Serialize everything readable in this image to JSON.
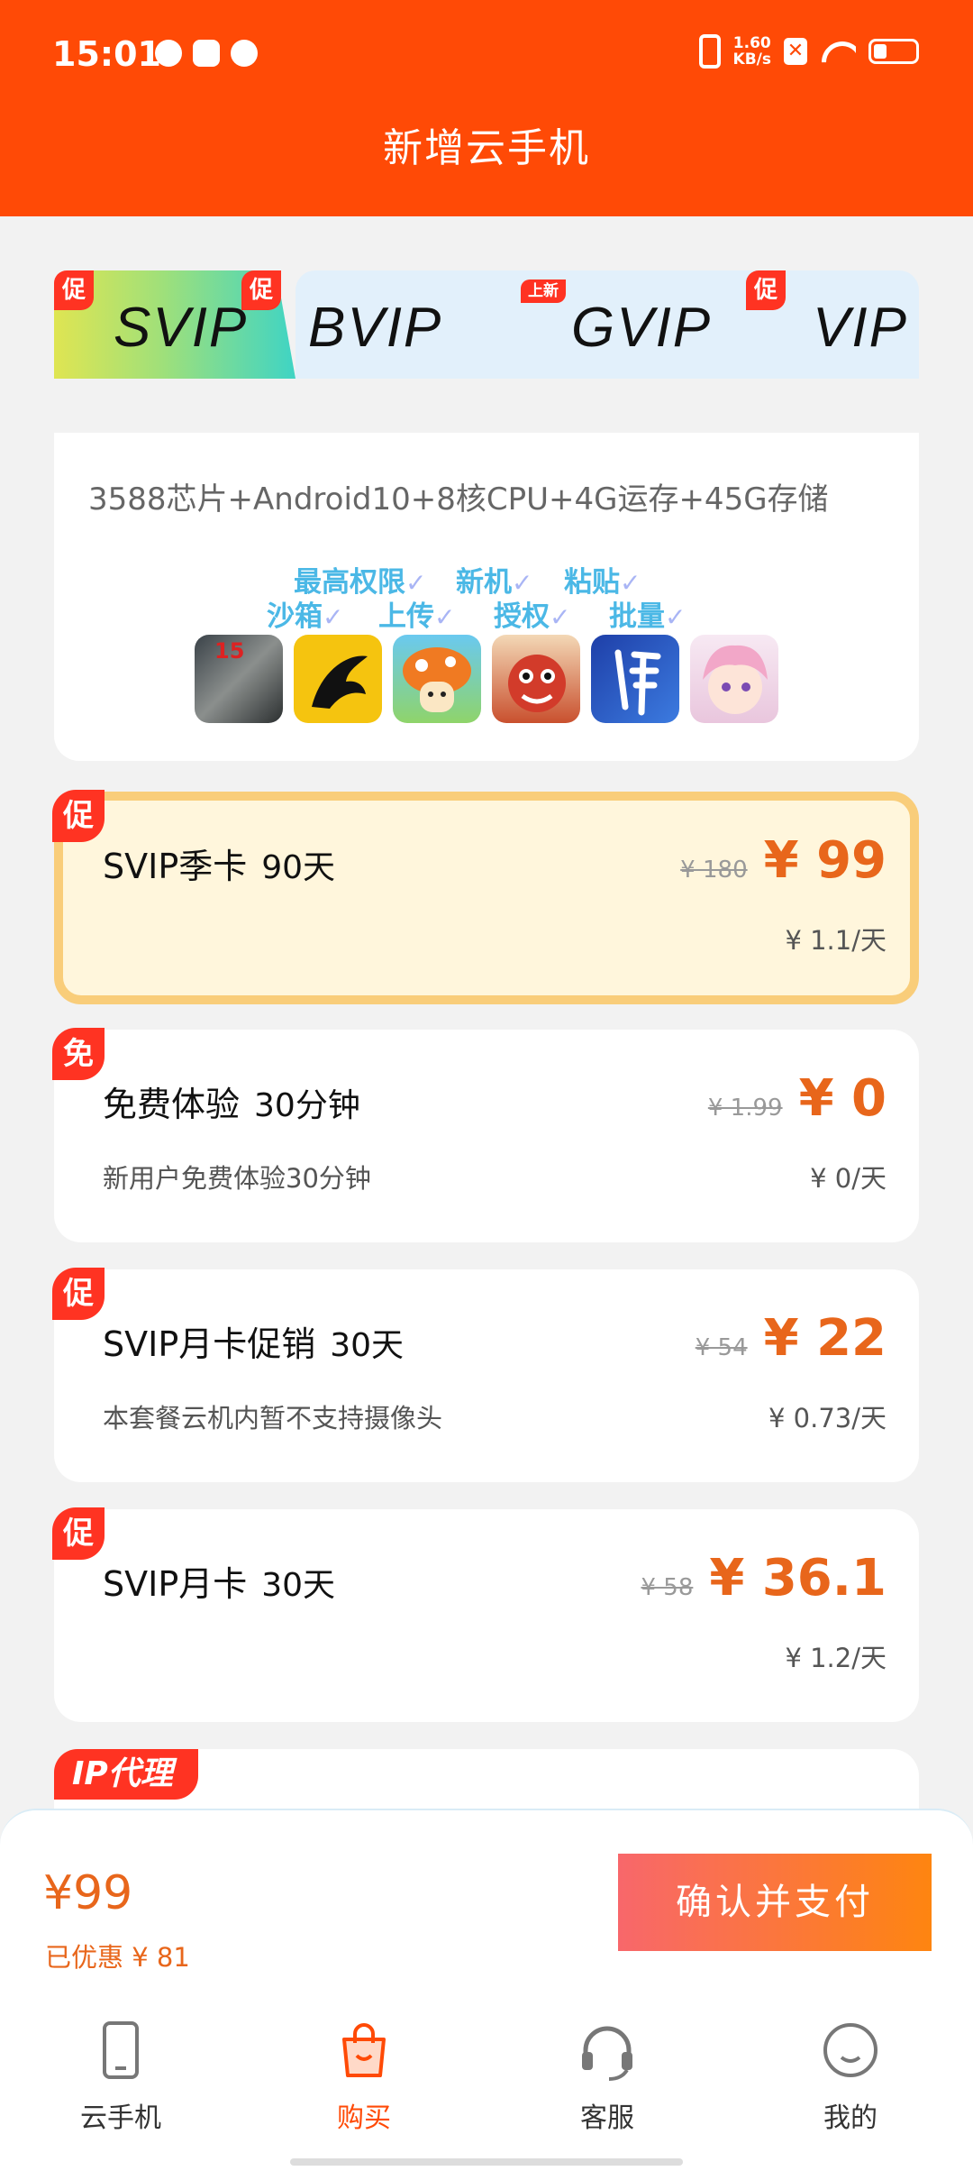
{
  "status_bar": {
    "time": "15:01",
    "net_speed_value": "1.60",
    "net_speed_unit": "KB/s",
    "icons": [
      "leaf-icon",
      "mail-icon",
      "cat-icon",
      "vibrate-icon",
      "close-box-icon",
      "wifi-icon",
      "battery-icon"
    ]
  },
  "header": {
    "title": "新增云手机"
  },
  "tabs": [
    {
      "label": "SVIP",
      "badge": "促",
      "active": true
    },
    {
      "label": "BVIP",
      "badge": "促",
      "active": false
    },
    {
      "label": "GVIP",
      "badge": "上新",
      "active": false
    },
    {
      "label": "VIP",
      "badge": "促",
      "active": false
    }
  ],
  "spec": {
    "line": "3588芯片+Android10+8核CPU+4G运存+45G存储",
    "features": [
      "最高权限",
      "新机",
      "粘贴",
      "沙箱",
      "上传",
      "授权",
      "批量"
    ],
    "feature_check": "✓",
    "games": [
      "15-days-game-icon",
      "dragon-game-icon",
      "mushroom-game-icon",
      "dragon-red-game-icon",
      "blue-calligraphy-game-icon",
      "anime-girl-game-icon"
    ],
    "game_badge": "15"
  },
  "plans": [
    {
      "badge": "促",
      "name": "SVIP季卡",
      "days": "90天",
      "note": "",
      "orig": "¥ 180",
      "price": "¥ 99",
      "per_day": "¥ 1.1/天",
      "selected": true
    },
    {
      "badge": "免",
      "name": "免费体验",
      "days": "30分钟",
      "note": "新用户免费体验30分钟",
      "orig": "¥ 1.99",
      "price": "¥ 0",
      "per_day": "¥ 0/天",
      "selected": false
    },
    {
      "badge": "促",
      "name": "SVIP月卡促销",
      "days": "30天",
      "note": "本套餐云机内暂不支持摄像头",
      "orig": "¥ 54",
      "price": "¥ 22",
      "per_day": "¥ 0.73/天",
      "selected": false
    },
    {
      "badge": "促",
      "name": "SVIP月卡",
      "days": "30天",
      "note": "",
      "orig": "¥ 58",
      "price": "¥ 36.1",
      "per_day": "¥ 1.2/天",
      "selected": false
    }
  ],
  "ip_card": {
    "tag": "IP代理"
  },
  "pay": {
    "total": "¥99",
    "saved": "已优惠 ¥ 81",
    "button": "确认并支付"
  },
  "nav": [
    {
      "label": "云手机",
      "icon": "phone-icon",
      "active": false
    },
    {
      "label": "购买",
      "icon": "shopping-bag-icon",
      "active": true
    },
    {
      "label": "客服",
      "icon": "headset-icon",
      "active": false
    },
    {
      "label": "我的",
      "icon": "smiley-icon",
      "active": false
    }
  ],
  "colors": {
    "header": "#ff4a06",
    "accent": "#e8661b",
    "badge": "#ff3322"
  }
}
